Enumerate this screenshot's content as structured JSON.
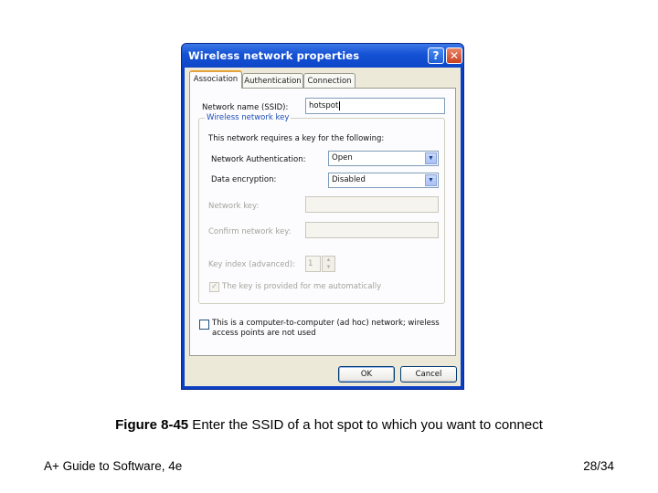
{
  "dialog": {
    "title": "Wireless network properties",
    "help_label": "?",
    "close_label": "✕",
    "tabs": [
      {
        "label": "Association",
        "active": true
      },
      {
        "label": "Authentication",
        "active": false
      },
      {
        "label": "Connection",
        "active": false
      }
    ],
    "ssid": {
      "label": "Network name (SSID):",
      "value": "hotspot"
    },
    "key_group": {
      "title": "Wireless network key",
      "intro": "This network requires a key for the following:",
      "auth": {
        "label": "Network Authentication:",
        "value": "Open"
      },
      "encryption": {
        "label": "Data encryption:",
        "value": "Disabled"
      },
      "network_key": {
        "label": "Network key:",
        "value": ""
      },
      "confirm_key": {
        "label": "Confirm network key:",
        "value": ""
      },
      "key_index": {
        "label": "Key index (advanced):",
        "value": "1"
      },
      "auto_key": {
        "label": "The key is provided for me automatically",
        "checked": true,
        "enabled": false
      }
    },
    "adhoc": {
      "line1": "This is a computer-to-computer (ad hoc) network; wireless",
      "line2": "access points are not used",
      "checked": false
    },
    "ok_label": "OK",
    "cancel_label": "Cancel"
  },
  "caption": {
    "figure": "Figure 8-45",
    "text": " Enter the SSID of a hot spot to which you want to connect"
  },
  "footer": {
    "left": "A+ Guide to Software, 4e",
    "right": "28/34"
  }
}
